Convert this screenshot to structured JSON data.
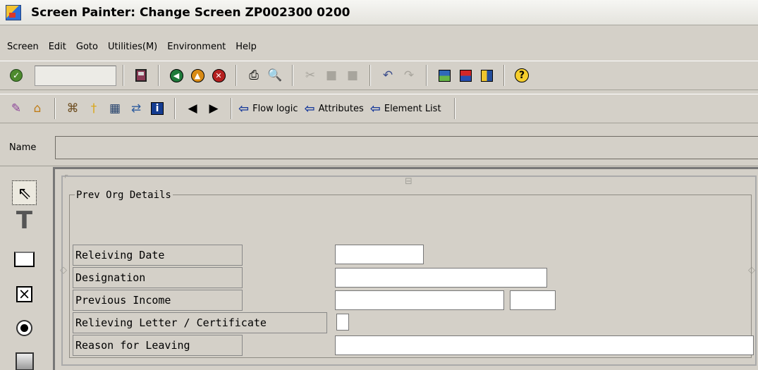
{
  "window": {
    "title": "Screen Painter:  Change Screen ZP002300 0200"
  },
  "menu": [
    "Screen",
    "Edit",
    "Goto",
    "Utilities(M)",
    "Environment",
    "Help"
  ],
  "toolbar2": {
    "flow_logic": "Flow logic",
    "attributes": "Attributes",
    "element_list": "Element List"
  },
  "name_field": {
    "label": "Name",
    "value": ""
  },
  "group": {
    "title": "Prev Org Details"
  },
  "fields": [
    {
      "label": "Releiving Date"
    },
    {
      "label": "Designation"
    },
    {
      "label": "Previous Income"
    },
    {
      "label": "Relieving Letter / Certificate"
    },
    {
      "label": "Reason for Leaving"
    }
  ]
}
